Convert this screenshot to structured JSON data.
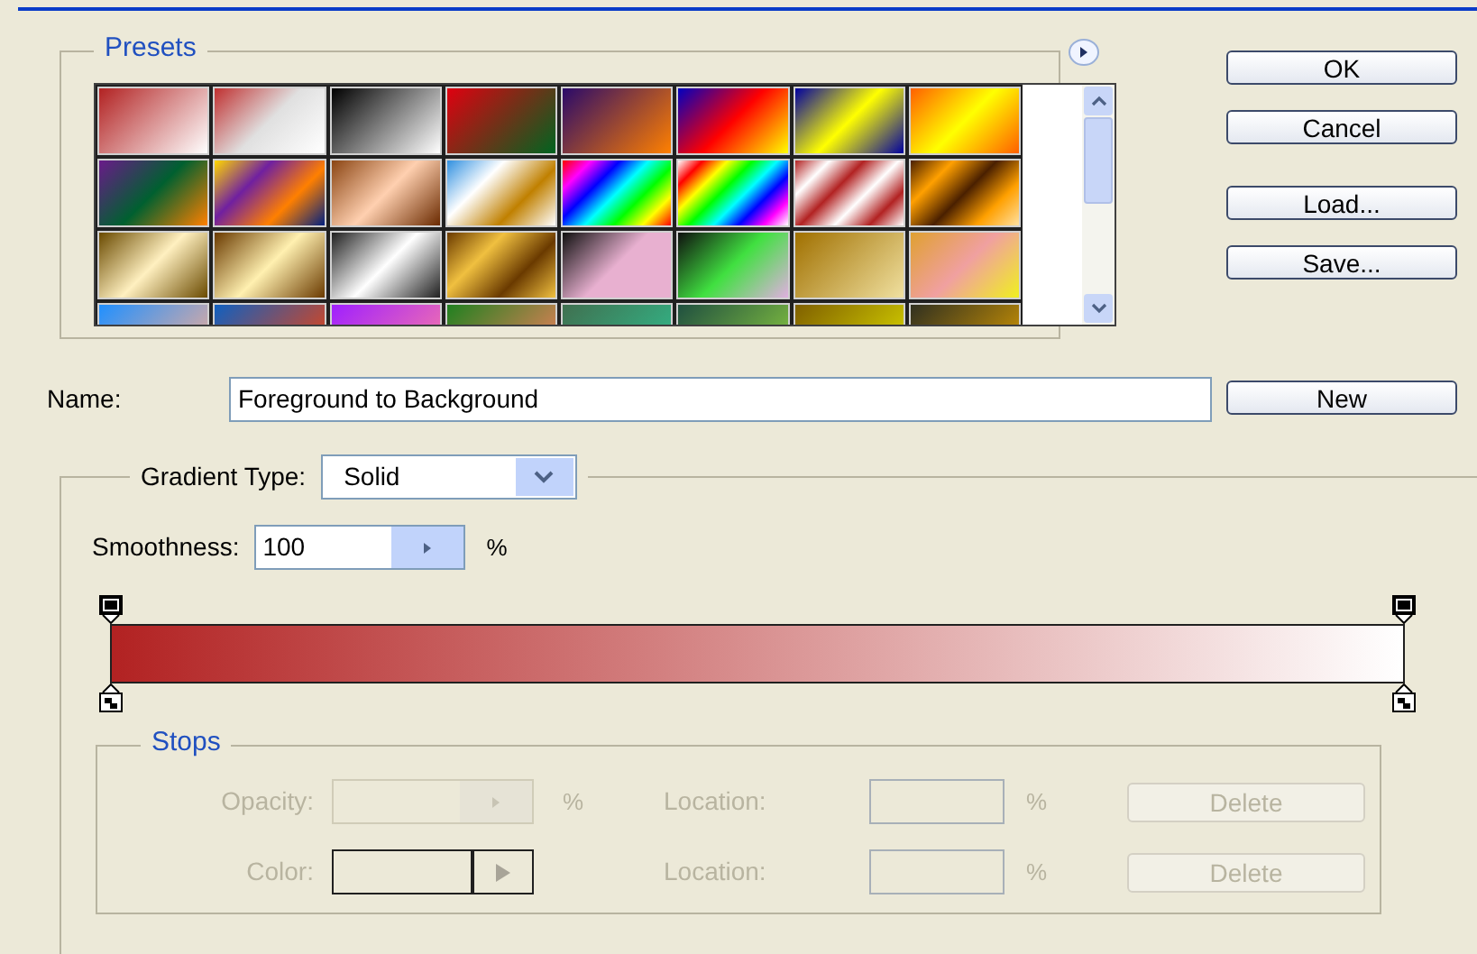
{
  "presets": {
    "title": "Presets"
  },
  "buttons": [
    "OK",
    "Cancel",
    "Load...",
    "Save..."
  ],
  "name": {
    "label": "Name:",
    "value": "Foreground to Background",
    "button": "New"
  },
  "gradient": {
    "type_label": "Gradient Type:",
    "type_value": "Solid",
    "smoothness_label": "Smoothness:",
    "smoothness_value": "100",
    "smoothness_unit": "%"
  },
  "stops": {
    "title": "Stops",
    "rows": [
      {
        "label": "Opacity:",
        "kind": "opacity",
        "unit": "%",
        "location_label": "Location:",
        "location_unit": "%",
        "button": "Delete",
        "disabled": true
      },
      {
        "label": "Color:",
        "kind": "color",
        "unit": "",
        "location_label": "Location:",
        "location_unit": "%",
        "button": "Delete",
        "disabled": true
      }
    ]
  }
}
